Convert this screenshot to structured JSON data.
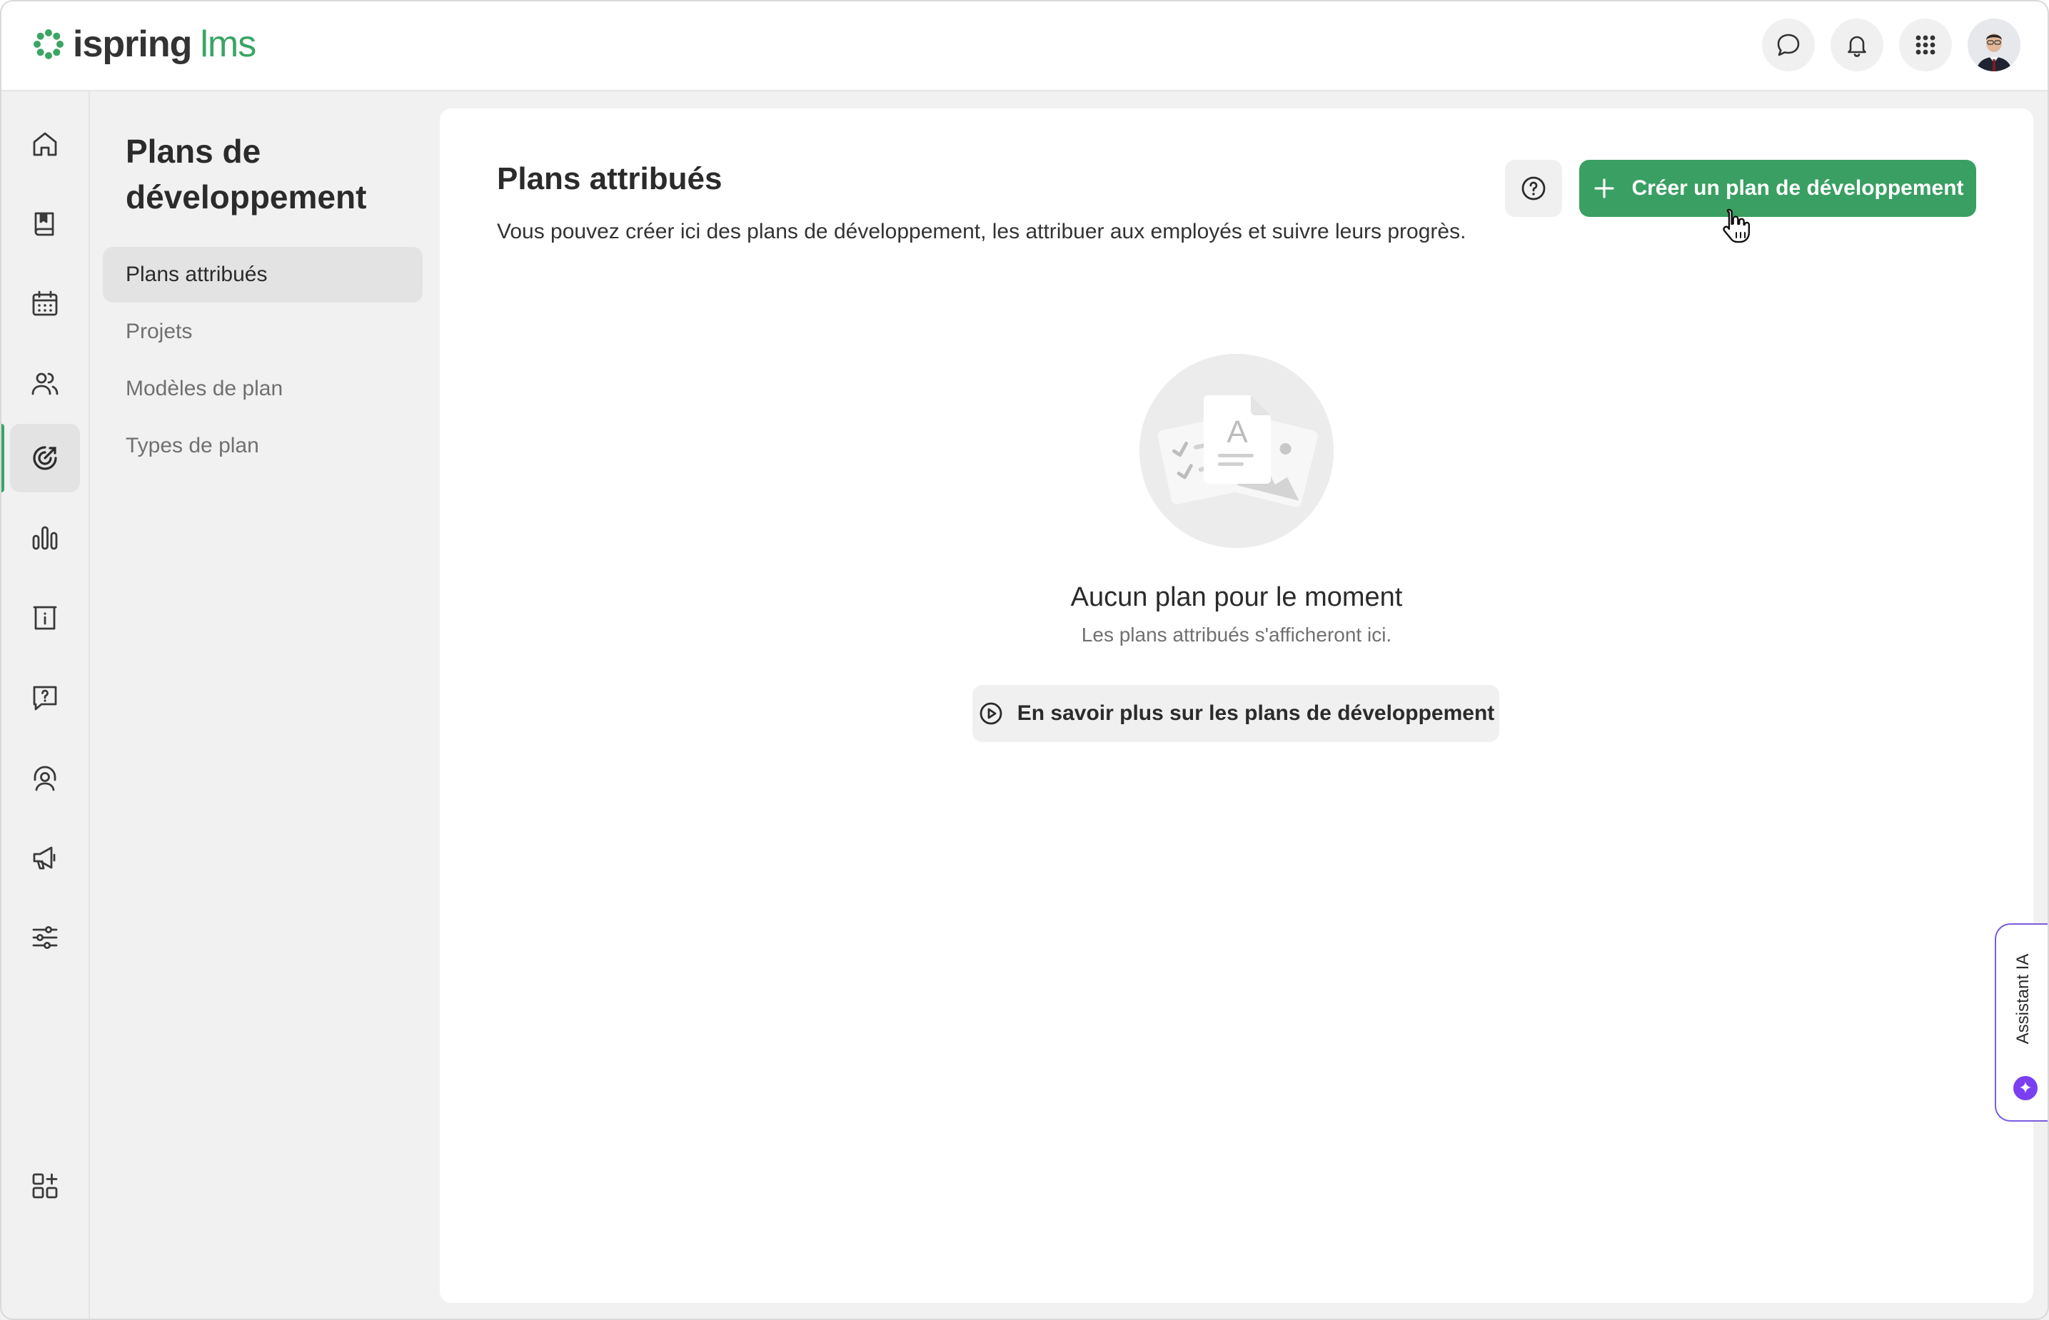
{
  "app": {
    "logo_text_1": "ispring",
    "logo_text_2": "lms"
  },
  "colors": {
    "brand_green": "#3aa564",
    "button_green": "#3a9f62",
    "ai_purple": "#7b3ff2"
  },
  "header": {
    "icons": [
      "chat-icon",
      "bell-icon",
      "apps-grid-icon",
      "user-avatar"
    ]
  },
  "rail": {
    "items": [
      {
        "icon": "home-icon"
      },
      {
        "icon": "book-icon"
      },
      {
        "icon": "calendar-icon"
      },
      {
        "icon": "users-icon"
      },
      {
        "icon": "target-icon",
        "active": true
      },
      {
        "icon": "bar-chart-icon"
      },
      {
        "icon": "info-board-icon"
      },
      {
        "icon": "question-chat-icon"
      },
      {
        "icon": "support-agent-icon"
      },
      {
        "icon": "megaphone-icon"
      },
      {
        "icon": "sliders-icon"
      },
      {
        "icon": "add-widget-icon"
      }
    ]
  },
  "section": {
    "title": "Plans de développement",
    "nav": [
      {
        "label": "Plans attribués",
        "active": true
      },
      {
        "label": "Projets"
      },
      {
        "label": "Modèles de plan"
      },
      {
        "label": "Types de plan"
      }
    ]
  },
  "main": {
    "title": "Plans attribués",
    "description": "Vous pouvez créer ici des plans de développement, les attribuer aux employés et suivre leurs progrès.",
    "create_button": "Créer un plan de développement",
    "help_icon": "question-circle-icon",
    "empty_state": {
      "title": "Aucun plan pour le moment",
      "subtitle": "Les plans attribués s'afficheront ici.",
      "learn_more_button": "En savoir plus sur les plans de développement"
    }
  },
  "assistant": {
    "label": "Assistant IA"
  }
}
